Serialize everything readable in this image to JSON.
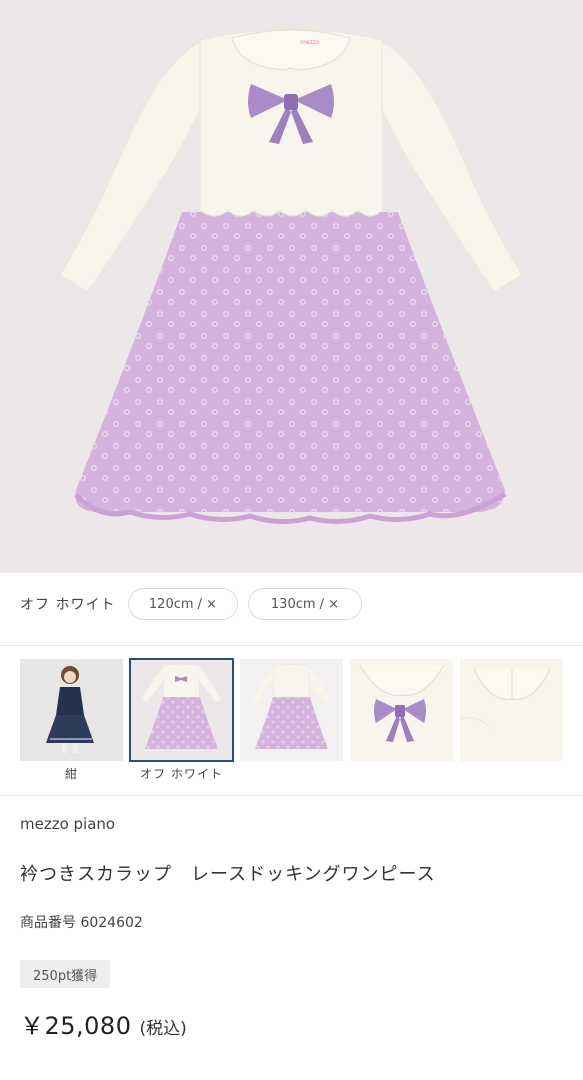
{
  "hero": {
    "image": "lavender-lace-dress-with-bow",
    "colors": {
      "background": "#ece8ea",
      "bodice": "#f8f5ec",
      "skirt": "#d4b4dc",
      "bow": "#a98bc8"
    },
    "brand_tag": "mezzo"
  },
  "variant": {
    "color_label": "オフ ホワイト",
    "sizes": [
      "120cm / ×",
      "130cm / ×"
    ]
  },
  "thumbnails": [
    {
      "caption": "紺",
      "image": "model-navy-dress",
      "selected": false
    },
    {
      "caption": "オフ ホワイト",
      "image": "dress-front-off-white",
      "selected": true
    },
    {
      "caption": "",
      "image": "dress-back",
      "selected": false
    },
    {
      "caption": "",
      "image": "collar-bow-detail",
      "selected": false
    },
    {
      "caption": "",
      "image": "collar-back-detail",
      "selected": false
    }
  ],
  "product": {
    "brand": "mezzo piano",
    "title": "衿つきスカラップ　レースドッキングワンピース",
    "sku": "商品番号 6024602",
    "points_badge": "250pt獲得",
    "price": "￥25,080",
    "tax_note": "(税込)"
  }
}
